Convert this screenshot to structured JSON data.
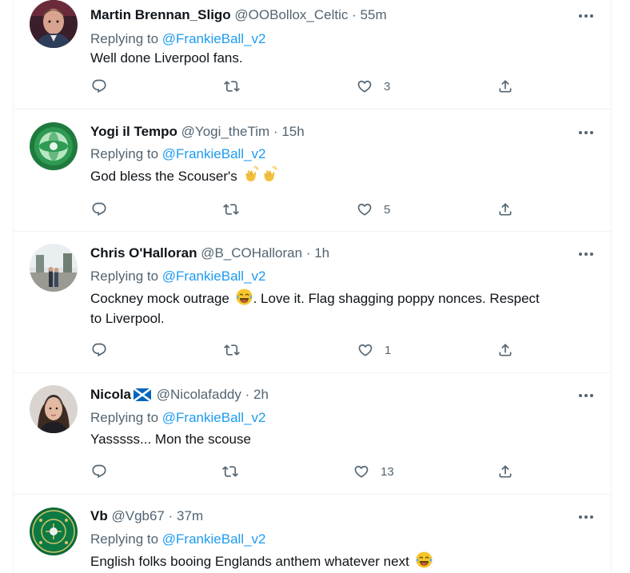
{
  "tweets": [
    {
      "name": "Martin Brennan_Sligo",
      "handle": "@OOBollox_Celtic",
      "dot": "·",
      "time": "55m",
      "replying_prefix": "Replying to ",
      "replying_to": "@FrankieBall_v2",
      "text": "Well done Liverpool fans.",
      "likes": "3"
    },
    {
      "name": "Yogi il Tempo",
      "handle": "@Yogi_theTim",
      "dot": "·",
      "time": "15h",
      "replying_prefix": "Replying to ",
      "replying_to": "@FrankieBall_v2",
      "text": "God bless the Scouser's",
      "likes": "5"
    },
    {
      "name": "Chris O'Halloran",
      "handle": "@B_COHalloran",
      "dot": "·",
      "time": "1h",
      "replying_prefix": "Replying to ",
      "replying_to": "@FrankieBall_v2",
      "text_line1": "Cockney mock outrage",
      "text_line1b": ". Love it. Flag shagging poppy nonces. Respect",
      "text_line2": "to Liverpool.",
      "likes": "1"
    },
    {
      "name": "Nicola",
      "handle": "@Nicolafaddy",
      "dot": "·",
      "time": "2h",
      "replying_prefix": "Replying to ",
      "replying_to": "@FrankieBall_v2",
      "text": "Yasssss... Mon the scouse",
      "likes": "13"
    },
    {
      "name": "Vb",
      "handle": "@Vgb67",
      "dot": "·",
      "time": "37m",
      "replying_prefix": "Replying to ",
      "replying_to": "@FrankieBall_v2",
      "text": "English folks booing Englands anthem whatever next"
    }
  ],
  "icons": {
    "reply": "reply-icon",
    "retweet": "retweet-icon",
    "like": "heart-icon",
    "share": "share-icon",
    "more": "more-icon",
    "clapping": "clapping-hands-emoji",
    "laughing": "tears-of-joy-emoji",
    "scotland_flag": "scotland-flag-icon"
  },
  "colors": {
    "link": "#1d9bf0",
    "secondary_text": "#536471",
    "primary_text": "#0f1419",
    "divider": "#eff3f4"
  }
}
